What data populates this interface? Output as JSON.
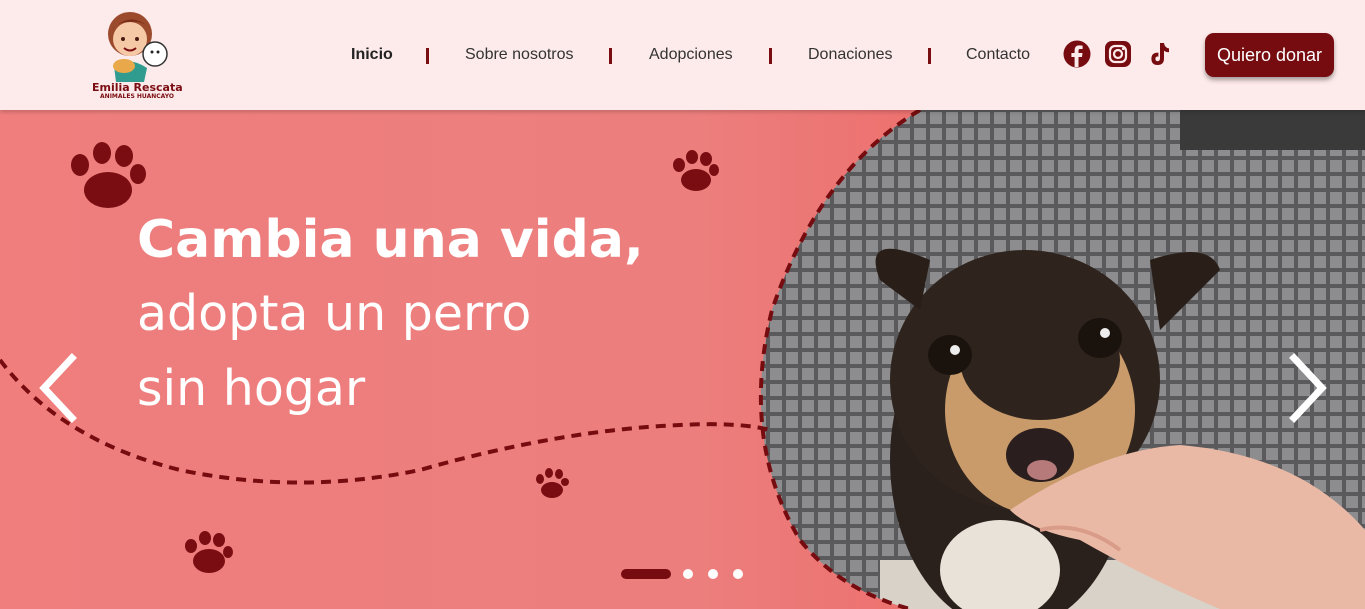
{
  "brand": {
    "name": "Emilia Rescata",
    "tagline": "ANIMALES HUANCAYO"
  },
  "nav": {
    "items": [
      {
        "label": "Inicio",
        "active": true
      },
      {
        "label": "Sobre nosotros",
        "active": false
      },
      {
        "label": "Adopciones",
        "active": false
      },
      {
        "label": "Donaciones",
        "active": false
      },
      {
        "label": "Contacto",
        "active": false
      }
    ]
  },
  "social": {
    "icons": [
      "facebook-icon",
      "instagram-icon",
      "tiktok-icon"
    ]
  },
  "cta": {
    "donate_label": "Quiero donar"
  },
  "hero": {
    "line1": "Cambia una vida,",
    "line2": "adopta un perro",
    "line3": "sin hogar",
    "slides_total": 4,
    "active_slide": 1
  },
  "colors": {
    "accent": "#760c10",
    "hero_bg": "#ec7b7a",
    "header_bg": "#fdeaea"
  }
}
